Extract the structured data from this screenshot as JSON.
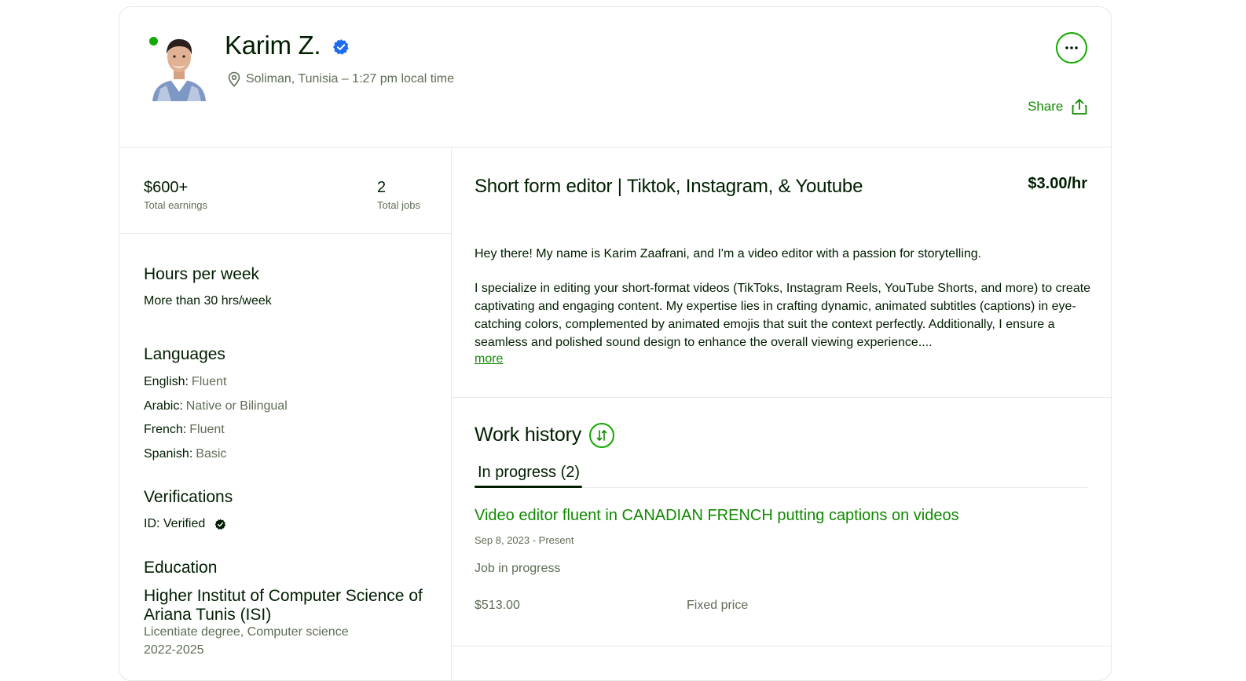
{
  "profile": {
    "name": "Karim Z.",
    "location": "Soliman, Tunisia – 1:27 pm local time",
    "share_label": "Share",
    "colors": {
      "accent": "#14a800",
      "link": "#108a00",
      "verified": "#1d6cf0"
    }
  },
  "stats": {
    "earnings_value": "$600+",
    "earnings_label": "Total earnings",
    "jobs_value": "2",
    "jobs_label": "Total jobs"
  },
  "hours": {
    "title": "Hours per week",
    "value": "More than 30 hrs/week"
  },
  "languages": {
    "title": "Languages",
    "items": [
      {
        "name": "English:",
        "level": "Fluent"
      },
      {
        "name": "Arabic:",
        "level": "Native or Bilingual"
      },
      {
        "name": "French:",
        "level": "Fluent"
      },
      {
        "name": "Spanish:",
        "level": "Basic"
      }
    ]
  },
  "verifications": {
    "title": "Verifications",
    "id_label": "ID: Verified"
  },
  "education": {
    "title": "Education",
    "school_line1": "Higher Institut of Computer Science of",
    "school_line2": "Ariana Tunis (ISI)",
    "degree": "Licentiate degree, Computer science",
    "years": "2022-2025"
  },
  "overview": {
    "title": "Short form editor | Tiktok, Instagram, & Youtube",
    "rate": "$3.00/hr",
    "bio_p1": "Hey there! My name is Karim Zaafrani, and I'm a video editor with a passion for storytelling.",
    "bio_p2": "I specialize in editing your short-format videos (TikToks, Instagram Reels, YouTube Shorts, and more) to create captivating and engaging content. My expertise lies in crafting dynamic, animated subtitles (captions) in eye-catching colors, complemented by animated emojis that suit the context perfectly. Additionally, I ensure a seamless and polished sound design to enhance the overall viewing experience....",
    "more_label": "more"
  },
  "work_history": {
    "title": "Work history",
    "tab_label": "In progress (2)",
    "job": {
      "title": "Video editor fluent in CANADIAN FRENCH putting captions on videos",
      "dates": "Sep 8, 2023 - Present",
      "status": "Job in progress",
      "price": "$513.00",
      "type": "Fixed price"
    }
  }
}
